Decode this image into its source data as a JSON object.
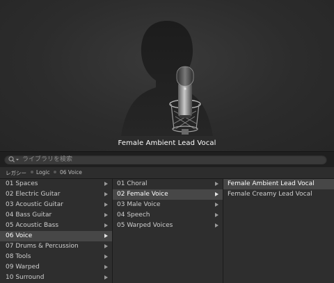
{
  "preview": {
    "patch_name": "Female Ambient Lead Vocal",
    "image": "female-singer-with-microphone"
  },
  "search": {
    "placeholder": "ライブラリを検索",
    "icon": "search-icon"
  },
  "breadcrumb": [
    "レガシー",
    "Logic",
    "06 Voice"
  ],
  "columns": {
    "categories": [
      {
        "label": "01 Spaces",
        "has_children": true,
        "selected": false
      },
      {
        "label": "02 Electric Guitar",
        "has_children": true,
        "selected": false
      },
      {
        "label": "03 Acoustic Guitar",
        "has_children": true,
        "selected": false
      },
      {
        "label": "04 Bass Guitar",
        "has_children": true,
        "selected": false
      },
      {
        "label": "05 Acoustic Bass",
        "has_children": true,
        "selected": false
      },
      {
        "label": "06 Voice",
        "has_children": true,
        "selected": true
      },
      {
        "label": "07 Drums & Percussion",
        "has_children": true,
        "selected": false
      },
      {
        "label": "08 Tools",
        "has_children": true,
        "selected": false
      },
      {
        "label": "09 Warped",
        "has_children": true,
        "selected": false
      },
      {
        "label": "10 Surround",
        "has_children": true,
        "selected": false
      }
    ],
    "subcategories": [
      {
        "label": "01 Choral",
        "has_children": true,
        "selected": false
      },
      {
        "label": "02 Female Voice",
        "has_children": true,
        "selected": true
      },
      {
        "label": "03 Male Voice",
        "has_children": true,
        "selected": false
      },
      {
        "label": "04 Speech",
        "has_children": true,
        "selected": false
      },
      {
        "label": "05 Warped Voices",
        "has_children": true,
        "selected": false
      }
    ],
    "patches": [
      {
        "label": "Female Ambient Lead Vocal",
        "has_children": false,
        "selected": true
      },
      {
        "label": "Female Creamy Lead Vocal",
        "has_children": false,
        "selected": false
      }
    ]
  },
  "colors": {
    "background": "#2b2b2b",
    "selection": "#474747",
    "text": "#cfcfcf"
  }
}
